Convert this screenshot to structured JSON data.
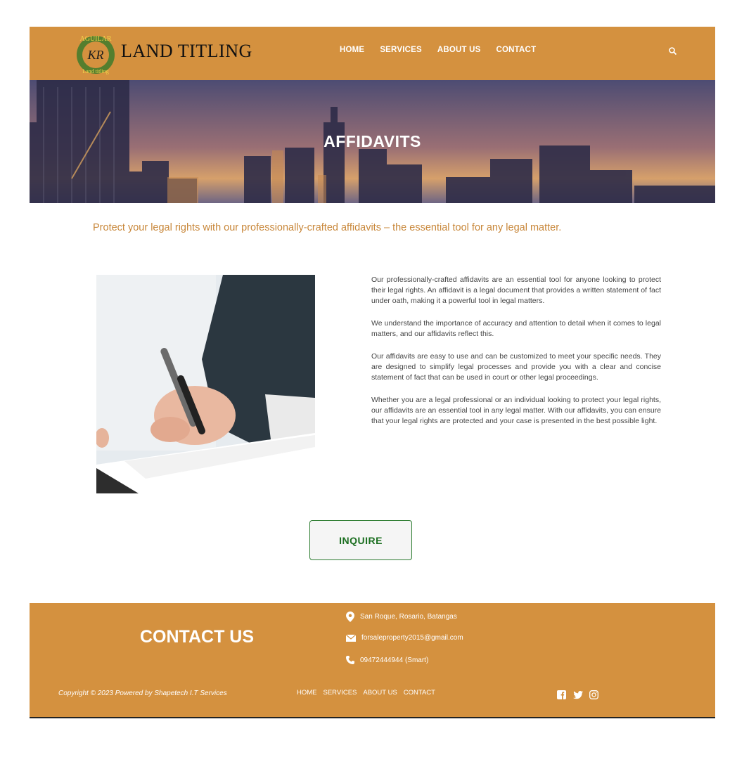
{
  "header": {
    "logo_text": "AGUILAR",
    "logo_sub": "Land titling",
    "logo_initials": "KR",
    "brand": "LAND TITLING",
    "nav": [
      "HOME",
      "SERVICES",
      "ABOUT US",
      "CONTACT"
    ],
    "search_icon": "search-icon"
  },
  "hero": {
    "title": "AFFIDAVITS"
  },
  "tagline": "Protect your legal rights with our professionally-crafted affidavits – the essential tool for any legal matter.",
  "content": {
    "paragraphs": [
      "Our professionally-crafted affidavits are an essential tool for anyone looking to protect their legal rights. An affidavit is a legal document that provides a written statement of fact under oath, making it a powerful tool in legal matters.",
      "We understand the importance of accuracy and attention to detail when it comes to legal matters, and our affidavits reflect this.",
      "Our affidavits are easy to use and can be customized to meet your specific needs. They are designed to simplify legal processes and provide you with a clear and concise statement of fact that can be used in court or other legal proceedings.",
      "Whether you are a legal professional or an individual looking to protect your legal rights, our affidavits are an essential tool in any legal matter. With our affidavits, you can ensure that your legal rights are protected and your case is presented in the best possible light."
    ],
    "inquire_label": "INQUIRE"
  },
  "footer": {
    "contact_title": "CONTACT US",
    "address": "San Roque, Rosario, Batangas",
    "email": "forsaleproperty2015@gmail.com",
    "phone": "09472444944 (Smart)",
    "copyright": "Copyright © 2023 Powered by Shapetech I.T Services",
    "nav": [
      "HOME",
      "SERVICES",
      "ABOUT US",
      "CONTACT"
    ],
    "social": [
      "facebook-icon",
      "twitter-icon",
      "instagram-icon"
    ]
  },
  "colors": {
    "brand_orange": "#d4913f",
    "tagline": "#c8873a",
    "button_green": "#2e7d32"
  }
}
